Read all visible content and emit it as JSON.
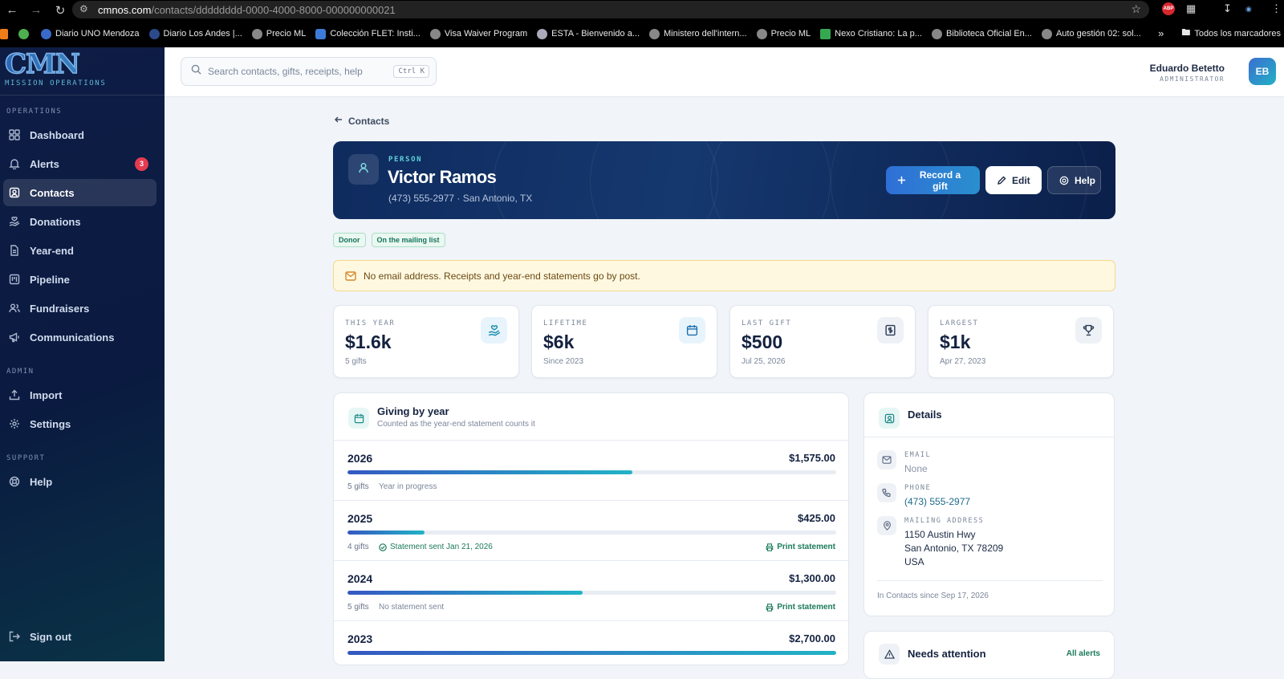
{
  "browser": {
    "url_host": "cmnos.com",
    "url_path": "/contacts/dddddddd-0000-4000-8000-000000000021",
    "bookmarks": [
      "Diario UNO Mendoza",
      "Diario Los Andes |...",
      "Precio ML",
      "Colección FLET: Insti...",
      "Visa Waiver Program",
      "ESTA - Bienvenido a...",
      "Ministero dell'intern...",
      "Precio ML",
      "Nexo Cristiano: La p...",
      "Biblioteca Oficial En...",
      "Auto gestión 02: sol..."
    ],
    "bookmarks_folder": "Todos los marcadores",
    "ext_abp": "ABP"
  },
  "sidebar": {
    "logo_text": "CMN",
    "logo_sub": "MISSION OPERATIONS",
    "sections": [
      {
        "label": "OPERATIONS",
        "items": [
          {
            "label": "Dashboard",
            "icon": "grid-icon"
          },
          {
            "label": "Alerts",
            "icon": "bell-icon",
            "badge": "3"
          },
          {
            "label": "Contacts",
            "icon": "contact-icon",
            "active": true
          },
          {
            "label": "Donations",
            "icon": "hand-heart-icon"
          },
          {
            "label": "Year-end",
            "icon": "document-icon"
          },
          {
            "label": "Pipeline",
            "icon": "kanban-icon"
          },
          {
            "label": "Fundraisers",
            "icon": "users-icon"
          },
          {
            "label": "Communications",
            "icon": "megaphone-icon"
          }
        ]
      },
      {
        "label": "ADMIN",
        "items": [
          {
            "label": "Import",
            "icon": "upload-icon"
          },
          {
            "label": "Settings",
            "icon": "gear-icon"
          }
        ]
      },
      {
        "label": "SUPPORT",
        "items": [
          {
            "label": "Help",
            "icon": "lifebuoy-icon"
          }
        ]
      }
    ],
    "sign_out": "Sign out"
  },
  "topbar": {
    "search_placeholder": "Search contacts, gifts, receipts, help",
    "search_shortcut": "Ctrl K",
    "user_name": "Eduardo Betetto",
    "user_role": "ADMINISTRATOR",
    "avatar_initials": "EB"
  },
  "back_label": "Contacts",
  "contact": {
    "kind": "PERSON",
    "name": "Victor Ramos",
    "meta": "(473) 555-2977 · San Antonio, TX",
    "buttons": {
      "record_gift": "Record a gift",
      "edit": "Edit",
      "help": "Help"
    },
    "tags": [
      "Donor",
      "On the mailing list"
    ]
  },
  "notice": "No email address. Receipts and year-end statements go by post.",
  "stats": [
    {
      "label": "THIS YEAR",
      "value": "$1.6k",
      "sub": "5 gifts",
      "icon": "hand-heart-icon"
    },
    {
      "label": "LIFETIME",
      "value": "$6k",
      "sub": "Since 2023",
      "icon": "calendar-icon"
    },
    {
      "label": "LAST GIFT",
      "value": "$500",
      "sub": "Jul 25, 2026",
      "icon": "receipt-icon"
    },
    {
      "label": "LARGEST",
      "value": "$1k",
      "sub": "Apr 27, 2023",
      "icon": "trophy-icon"
    }
  ],
  "giving": {
    "title": "Giving by year",
    "subtitle": "Counted as the year-end statement counts it",
    "years": [
      {
        "year": "2026",
        "amount": "$1,575.00",
        "fraction": 0.583,
        "gifts": "5 gifts",
        "status": "Year in progress",
        "status_kind": "plain",
        "print": ""
      },
      {
        "year": "2025",
        "amount": "$425.00",
        "fraction": 0.157,
        "gifts": "4 gifts",
        "status": "Statement sent Jan 21, 2026",
        "status_kind": "ok",
        "print": "Print statement"
      },
      {
        "year": "2024",
        "amount": "$1,300.00",
        "fraction": 0.481,
        "gifts": "5 gifts",
        "status": "No statement sent",
        "status_kind": "plain",
        "print": "Print statement"
      },
      {
        "year": "2023",
        "amount": "$2,700.00",
        "fraction": 1.0,
        "gifts": "",
        "status": "",
        "status_kind": "plain",
        "print": ""
      }
    ]
  },
  "details": {
    "title": "Details",
    "email_label": "EMAIL",
    "email_value": "None",
    "phone_label": "PHONE",
    "phone_value": "(473) 555-2977",
    "address_label": "MAILING ADDRESS",
    "address_lines": [
      "1150 Austin Hwy",
      "San Antonio, TX 78209",
      "USA"
    ],
    "since": "In Contacts since Sep 17, 2026"
  },
  "attention": {
    "title": "Needs attention",
    "link": "All alerts"
  },
  "colors": {
    "accent": "#2f6fd6",
    "teal": "#22b3c6",
    "success": "#1b7a5c",
    "alert": "#e53b4f"
  }
}
